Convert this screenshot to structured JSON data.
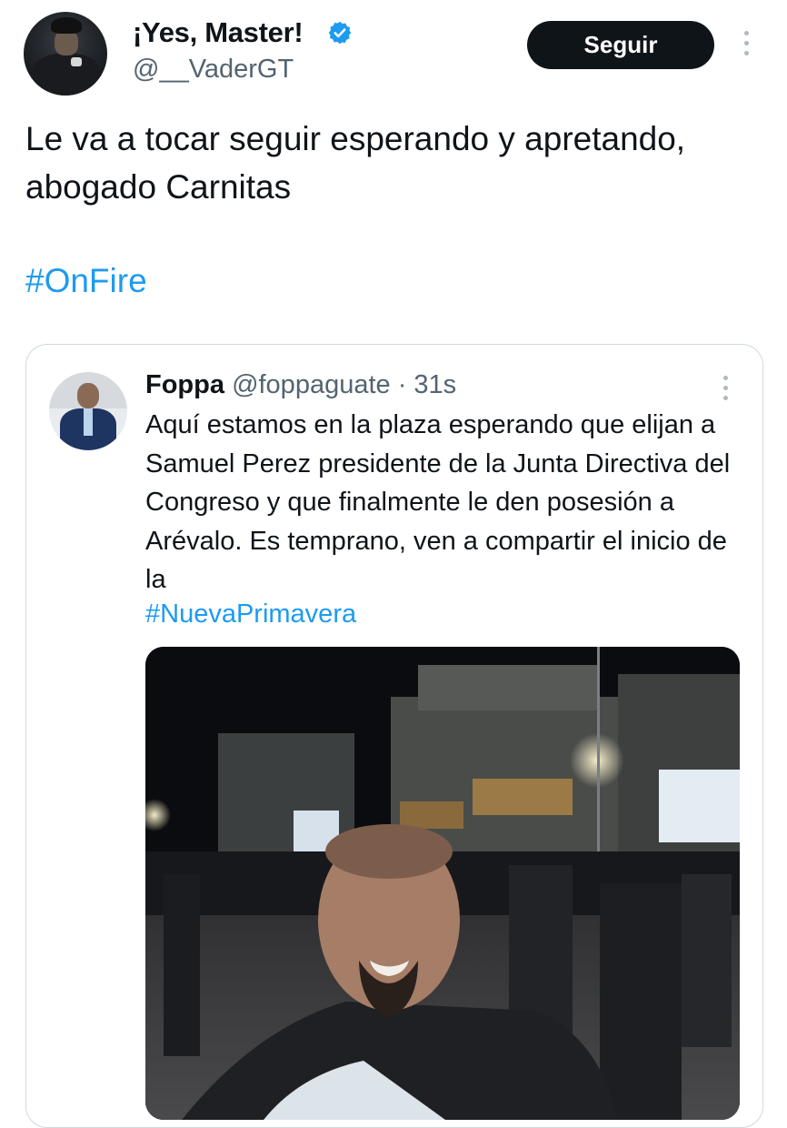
{
  "tweet": {
    "author": {
      "display_name": "¡Yes, Master!",
      "handle": "@__VaderGT",
      "verified": true
    },
    "follow_label": "Seguir",
    "text": "Le va a tocar seguir esperando y apretando, abogado Carnitas",
    "hashtag": "#OnFire"
  },
  "quoted": {
    "name": "Foppa",
    "meta": "@foppaguate · 31s",
    "text": "Aquí estamos en la plaza esperando que elijan a Samuel Perez presidente de la Junta Directiva del Congreso y que finalmente le den posesión a Arévalo. Es temprano, ven a compartir el inicio de la",
    "hashtag": "#NuevaPrimavera"
  },
  "colors": {
    "accent": "#1d9bf0",
    "text": "#0f1419",
    "secondary": "#536471",
    "button_bg": "#0f1419"
  },
  "icons": [
    "verified-badge-icon",
    "more-options-icon"
  ]
}
